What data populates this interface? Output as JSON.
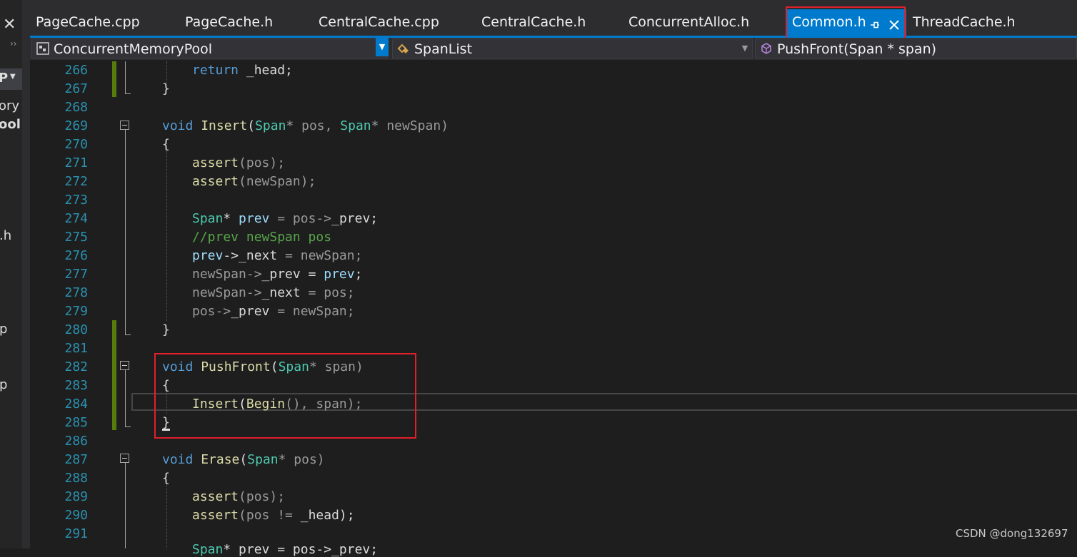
{
  "left_panel": {
    "close_glyph": "✕",
    "overflow_glyph": "››",
    "fragments": [
      "P",
      "ory",
      "ool",
      ".h",
      "p",
      "p"
    ]
  },
  "tabs": [
    {
      "label": "PageCache.cpp",
      "active": false
    },
    {
      "label": "PageCache.h",
      "active": false
    },
    {
      "label": "CentralCache.cpp",
      "active": false
    },
    {
      "label": "CentralCache.h",
      "active": false
    },
    {
      "label": "ConcurrentAlloc.h",
      "active": false
    },
    {
      "label": "Common.h",
      "active": true
    },
    {
      "label": "ThreadCache.h",
      "active": false
    }
  ],
  "navbar": {
    "project": "ConcurrentMemoryPool",
    "scope": "SpanList",
    "member": "PushFront(Span * span)"
  },
  "lines": [
    {
      "n": "266"
    },
    {
      "n": "267"
    },
    {
      "n": "268"
    },
    {
      "n": "269"
    },
    {
      "n": "270"
    },
    {
      "n": "271"
    },
    {
      "n": "272"
    },
    {
      "n": "273"
    },
    {
      "n": "274"
    },
    {
      "n": "275"
    },
    {
      "n": "276"
    },
    {
      "n": "277"
    },
    {
      "n": "278"
    },
    {
      "n": "279"
    },
    {
      "n": "280"
    },
    {
      "n": "281"
    },
    {
      "n": "282"
    },
    {
      "n": "283"
    },
    {
      "n": "284"
    },
    {
      "n": "285"
    },
    {
      "n": "286"
    },
    {
      "n": "287"
    },
    {
      "n": "288"
    },
    {
      "n": "289"
    },
    {
      "n": "290"
    },
    {
      "n": "291"
    }
  ],
  "code": {
    "l266": {
      "kw": "return",
      "rest": " _head;"
    },
    "l267": "}",
    "l269": {
      "kw": "void",
      "fn": "Insert",
      "t1": "Span",
      "p1": "* pos, ",
      "t2": "Span",
      "p2": "* newSpan)",
      "open": "("
    },
    "l270": "{",
    "l271": {
      "fn": "assert",
      "arg": "(pos);"
    },
    "l272": {
      "fn": "assert",
      "arg": "(newSpan);"
    },
    "l274": {
      "ty": "Span",
      "a": "* ",
      "v": "prev",
      "b": " = pos->",
      "m": "_prev",
      "c": ";"
    },
    "l275": "//prev newSpan pos",
    "l276": {
      "v": "prev",
      "a": "->",
      "m": "_next",
      "b": " = newSpan;"
    },
    "l277": {
      "a": "newSpan->",
      "m": "_prev",
      "b": " = ",
      "v": "prev",
      "c": ";"
    },
    "l278": {
      "a": "newSpan->",
      "m": "_next",
      "b": " = pos;"
    },
    "l279": {
      "a": "pos->",
      "m": "_prev",
      "b": " = newSpan;"
    },
    "l280": "}",
    "l282": {
      "kw": "void",
      "fn": "PushFront",
      "open": "(",
      "t1": "Span",
      "p1": "* span)"
    },
    "l283": "{",
    "l284": {
      "fn": "Insert",
      "a": "(",
      "fn2": "Begin",
      "b": "(), span);"
    },
    "l285": "}",
    "l287": {
      "kw": "void",
      "fn": "Erase",
      "open": "(",
      "t1": "Span",
      "p1": "* pos)"
    },
    "l288": "{",
    "l289": {
      "fn": "assert",
      "arg": "(pos);"
    },
    "l290": {
      "fn": "assert",
      "a": "(pos != ",
      "m": "_head",
      "b": ");"
    },
    "l292": {
      "ty": "Span",
      "a": "* prev = pos->_prev;"
    }
  },
  "watermark": "CSDN @dong132697",
  "colors": {
    "keyword": "#569cd6",
    "type": "#4ec9b0",
    "function": "#dcdcaa",
    "comment": "#57a64a",
    "line_number": "#2b91af",
    "highlight_box": "#e0202a",
    "active_tab": "#007acc"
  }
}
